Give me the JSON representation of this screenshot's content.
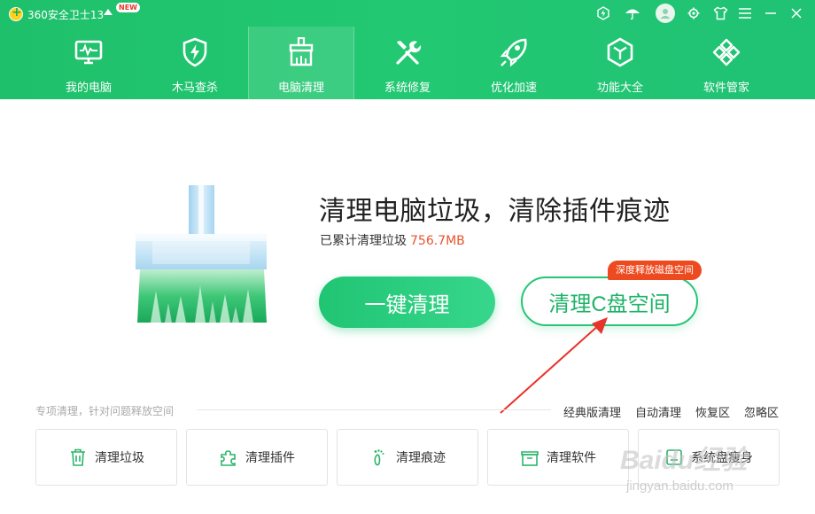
{
  "titlebar": {
    "app_title": "360安全卫士13",
    "new_badge": "NEW"
  },
  "nav": {
    "items": [
      {
        "label": "我的电脑",
        "icon": "monitor-icon"
      },
      {
        "label": "木马查杀",
        "icon": "shield-bolt-icon"
      },
      {
        "label": "电脑清理",
        "icon": "broom-icon",
        "active": true
      },
      {
        "label": "系统修复",
        "icon": "wrench-screwdriver-icon"
      },
      {
        "label": "优化加速",
        "icon": "rocket-icon"
      },
      {
        "label": "功能大全",
        "icon": "cube-icon"
      },
      {
        "label": "软件管家",
        "icon": "apps-icon"
      }
    ]
  },
  "main": {
    "headline": "清理电脑垃圾，清除插件痕迹",
    "sub_prefix": "已累计清理垃圾",
    "cleaned_amount": "756.7MB",
    "primary_button": "一键清理",
    "secondary_button": "清理C盘空间",
    "secondary_tag": "深度释放磁盘空间"
  },
  "special": {
    "label": "专项清理，针对问题释放空间",
    "links": [
      "经典版清理",
      "自动清理",
      "恢复区",
      "忽略区"
    ]
  },
  "cards": [
    {
      "label": "清理垃圾",
      "icon": "trash-icon"
    },
    {
      "label": "清理插件",
      "icon": "puzzle-icon"
    },
    {
      "label": "清理痕迹",
      "icon": "footprint-icon"
    },
    {
      "label": "清理软件",
      "icon": "box-icon"
    },
    {
      "label": "系统盘瘦身",
      "icon": "disk-icon"
    }
  ],
  "watermark": {
    "brand": "Baidu经验",
    "url": "jingyan.baidu.com"
  },
  "colors": {
    "header_green": "#1fc06b",
    "accent_orange": "#e8542b",
    "tag_red": "#ee4a1f"
  }
}
